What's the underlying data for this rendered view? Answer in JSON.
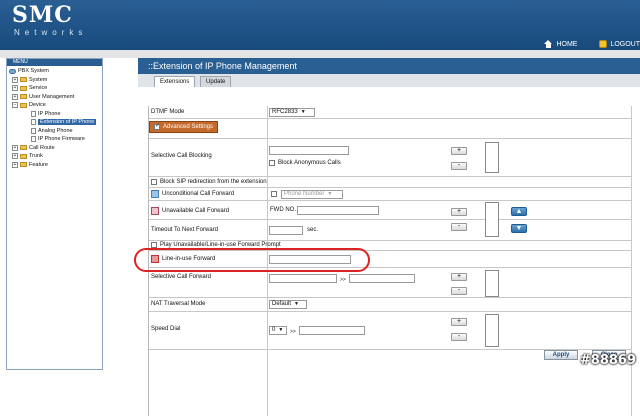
{
  "brand": {
    "name": "SMC",
    "tagline": "Networks"
  },
  "top_links": {
    "home": "HOME",
    "logout": "LOGOUT"
  },
  "sidebar": {
    "menu_title": "MENU",
    "root": "PBX System",
    "items": [
      "System",
      "Service",
      "User Management",
      "Device"
    ],
    "device_children": [
      "IP Phone",
      "Extension of IP Phone",
      "Analog Phone",
      "IP Phone Firmware"
    ],
    "bottom_items": [
      "Call Route",
      "Trunk",
      "Feature"
    ]
  },
  "page": {
    "title": "::Extension of IP Phone Management",
    "tabs": [
      "Extensions",
      "Update"
    ]
  },
  "form": {
    "dtmf_label": "DTMF Mode",
    "dtmf_value": "RFC2833",
    "advanced_label": "Advanced Settings",
    "selective_call_blocking": "Selective Call Blocking",
    "block_anonymous": "Block Anonymous Calls",
    "block_sip": "Block SIP redirection from the extension",
    "unconditional_forward": "Unconditional Call Forward",
    "phone_number_placeholder": "Phone Number",
    "unavailable_forward": "Unavailable Call Forward",
    "fwd_no": "FWD NO.",
    "timeout_label": "Timeout To Next Forward",
    "sec": "sec.",
    "play_prompt": "Play Unavailable/Line-in-use Forward Prompt",
    "line_in_use_forward": "Line-in-use Forward",
    "selective_forward": "Selective Call Forward",
    "arrow_sep": ">>",
    "nat_label": "NAT Traversal Mode",
    "nat_value": "Default",
    "speed_dial_label": "Speed Dial",
    "speed_dial_value": "0",
    "plus": "+",
    "minus": "-"
  },
  "buttons": {
    "apply": "Apply",
    "close": "Close"
  },
  "watermark": "#88869",
  "colors": {
    "header": "#1f5487",
    "title_bar": "#2a5f94",
    "highlight": "#c46a2c",
    "oval": "#dd2222"
  }
}
